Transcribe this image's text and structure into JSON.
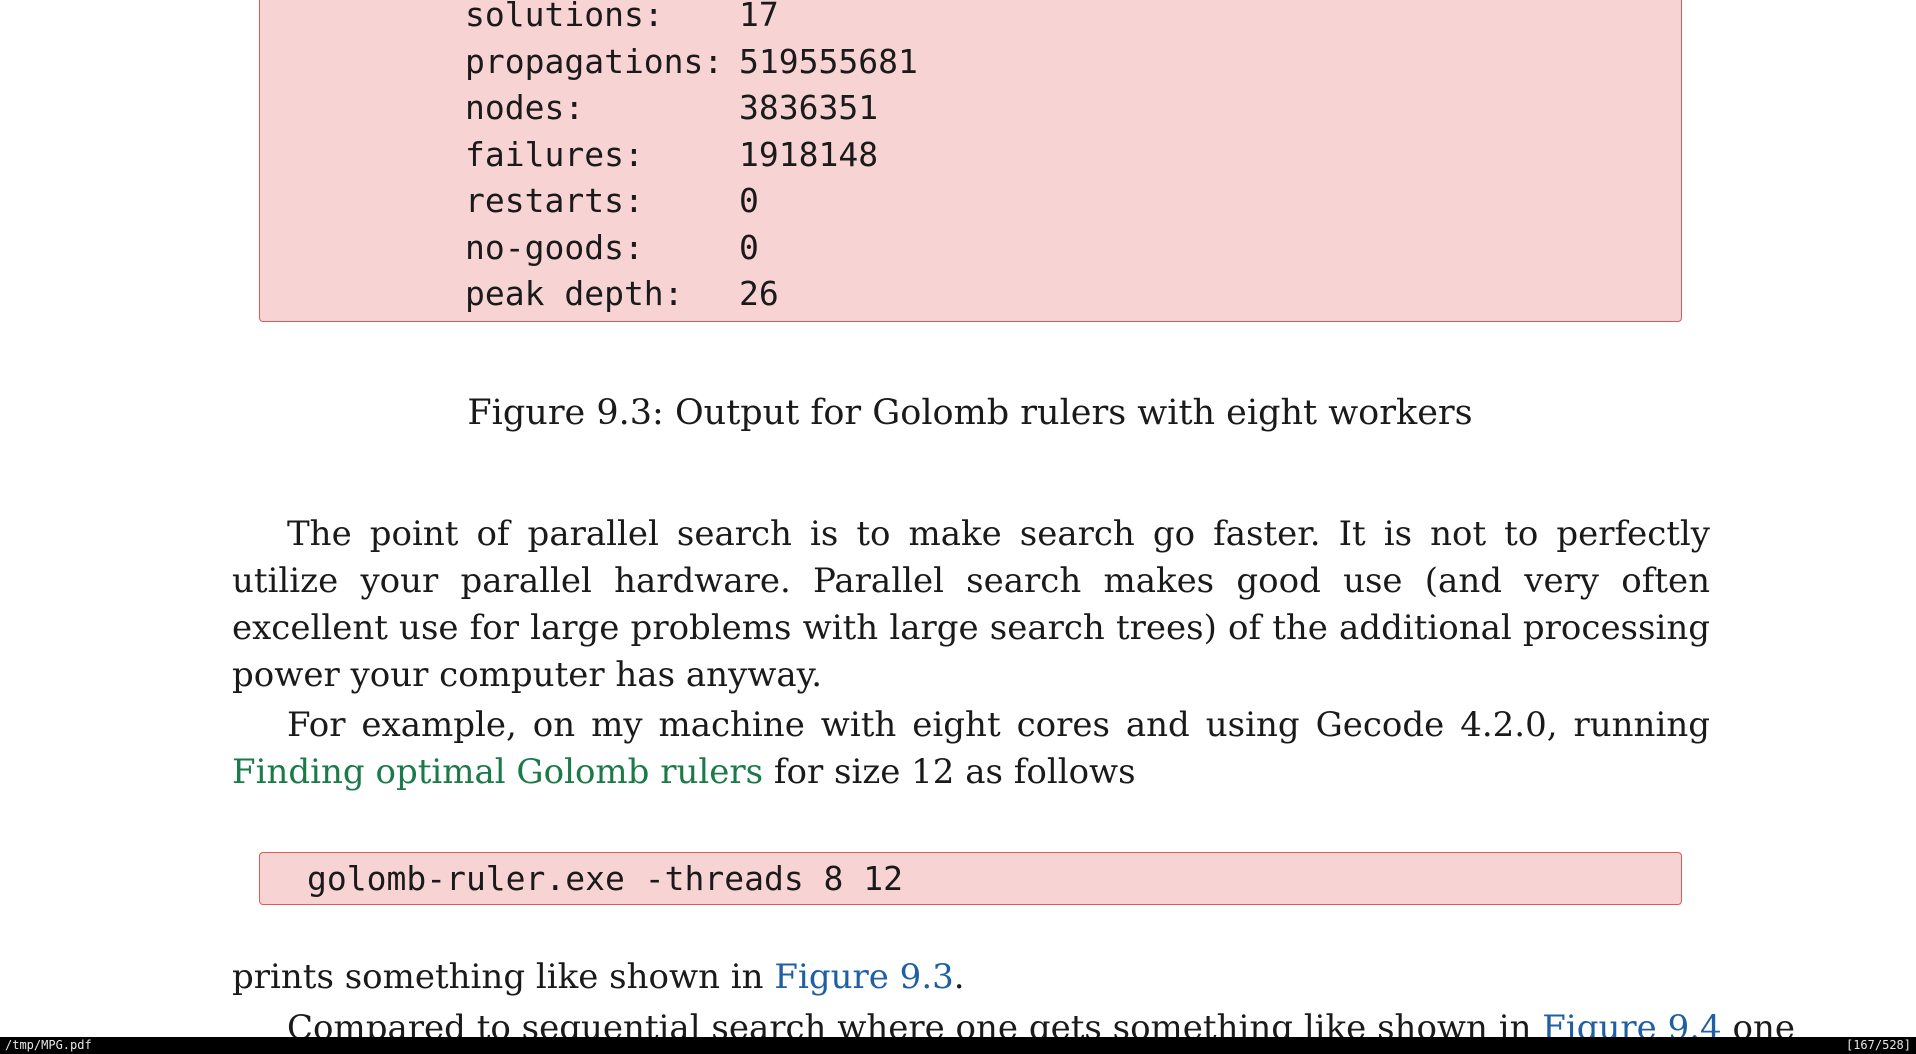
{
  "figure_output": {
    "rows": [
      {
        "key": "solutions:",
        "value": "17"
      },
      {
        "key": "propagations:",
        "value": "519555681"
      },
      {
        "key": "nodes:",
        "value": "3836351"
      },
      {
        "key": "failures:",
        "value": "1918148"
      },
      {
        "key": "restarts:",
        "value": "0"
      },
      {
        "key": "no-goods:",
        "value": "0"
      },
      {
        "key": "peak depth:",
        "value": "26"
      }
    ]
  },
  "caption": "Figure 9.3: Output for Golomb rulers with eight workers",
  "paragraph1": "The point of parallel search is to make search go faster. It is not to perfectly utilize your parallel hardware. Parallel search makes good use (and very often excellent use for large problems with large search trees) of the additional processing power your computer has anyway.",
  "paragraph2": {
    "before": "For example, on my machine with eight cores and using Gecode 4.2.0, running ",
    "link": "Finding optimal Golomb rulers",
    "after": " for size 12 as follows"
  },
  "command": "golomb-ruler.exe -threads 8 12",
  "paragraph3": {
    "before": "prints something like shown in ",
    "link": "Figure 9.3",
    "after": "."
  },
  "paragraph4": {
    "before": "Compared to sequential search where one gets something like shown in ",
    "link": "Figure 9.4",
    "after": " one"
  },
  "statusbar": {
    "file": "/tmp/MPG.pdf",
    "pages": "[167/528]"
  }
}
